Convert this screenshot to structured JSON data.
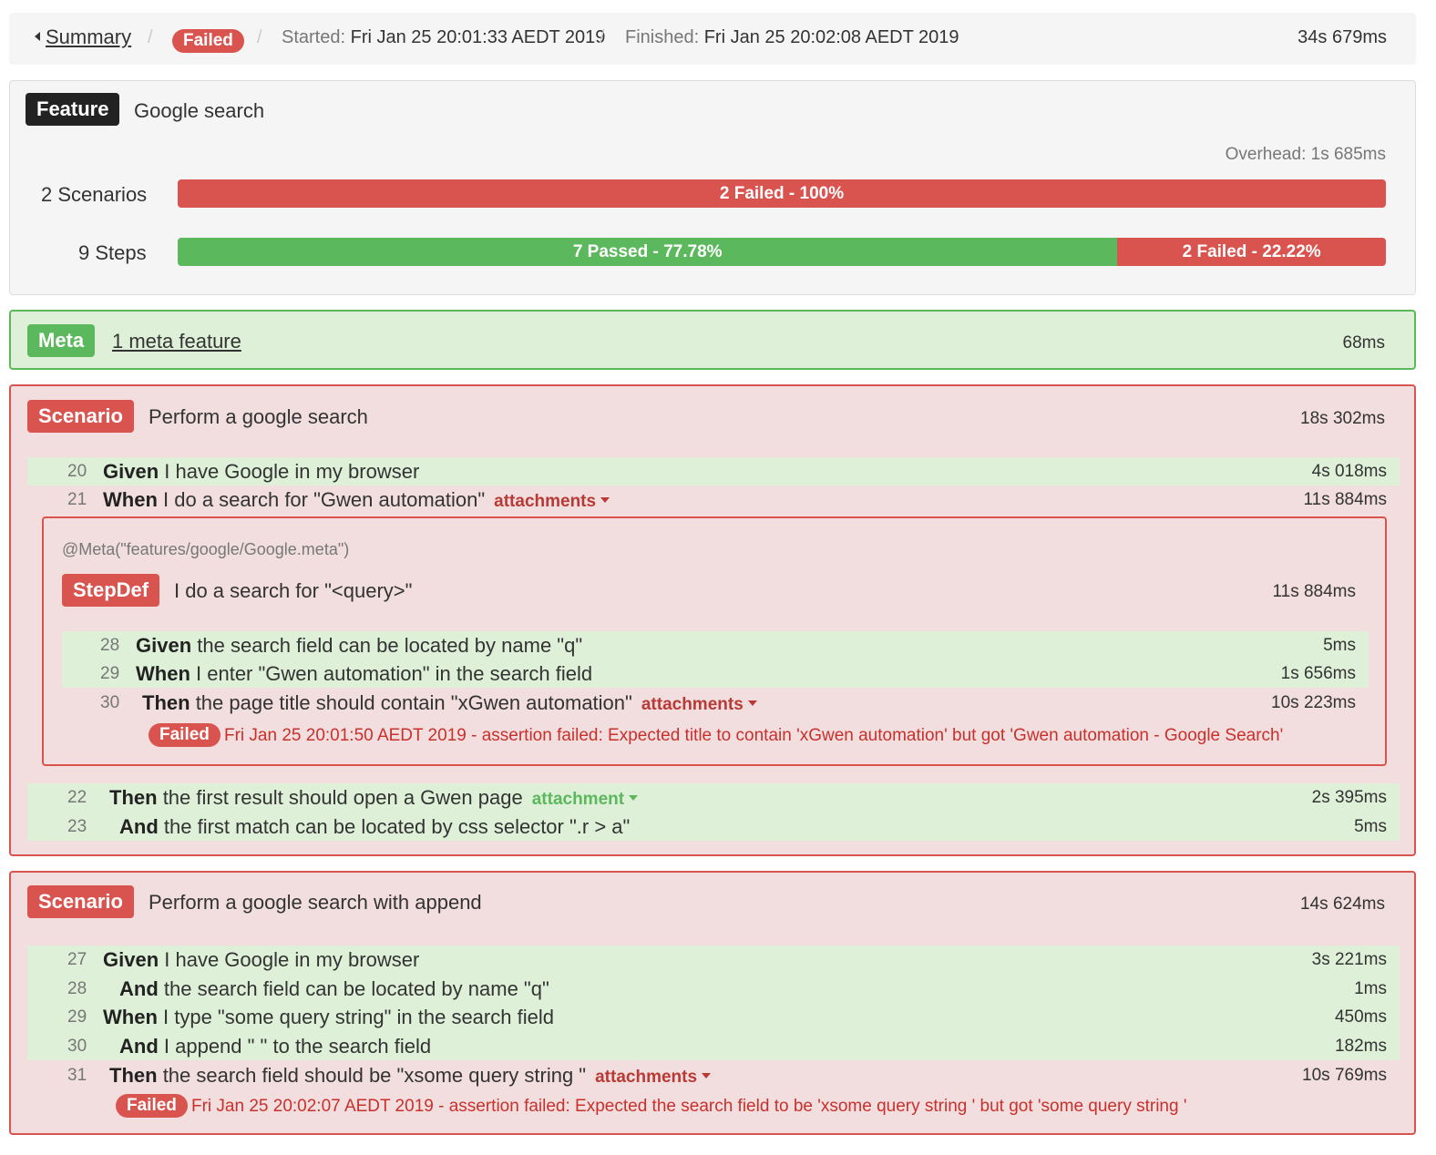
{
  "breadcrumb": {
    "summary": "Summary",
    "status": "Failed",
    "started_label": "Started:",
    "started": "Fri Jan 25 20:01:33 AEDT 2019",
    "finished_label": "Finished:",
    "finished": "Fri Jan 25 20:02:08 AEDT 2019",
    "duration": "34s 679ms"
  },
  "feature": {
    "label": "Feature",
    "name": "Google search",
    "overhead": "Overhead: 1s 685ms",
    "scenarios_label": "2 Scenarios",
    "scenarios_bar": [
      {
        "text": "2 Failed - 100%",
        "status": "failed",
        "percent": 100
      }
    ],
    "steps_label": "9 Steps",
    "steps_bar": [
      {
        "text": "7 Passed - 77.78%",
        "status": "passed",
        "percent": 77.78
      },
      {
        "text": "2 Failed - 22.22%",
        "status": "failed",
        "percent": 22.22
      }
    ]
  },
  "meta": {
    "label": "Meta",
    "link": "1 meta feature",
    "duration": "68ms"
  },
  "scenario1": {
    "label": "Scenario",
    "name": "Perform a google search",
    "duration": "18s 302ms",
    "steps": [
      {
        "line": "20",
        "keyword": "Given",
        "text": "I have Google in my browser",
        "duration": "4s 018ms"
      },
      {
        "line": "21",
        "keyword": "When",
        "text": "I do a search for \"Gwen automation\"",
        "duration": "11s 884ms",
        "attachment": "attachments"
      },
      {
        "line": "22",
        "keyword": "Then",
        "text": "the first result should open a Gwen page",
        "duration": "2s 395ms",
        "attachment": "attachment"
      },
      {
        "line": "23",
        "keyword": "And",
        "text": "the first match can be located by css selector \".r > a\"",
        "duration": "5ms"
      }
    ],
    "stepdef": {
      "annotation": "@Meta(\"features/google/Google.meta\")",
      "label": "StepDef",
      "name": "I do a search for \"<query>\"",
      "duration": "11s 884ms",
      "steps": [
        {
          "line": "28",
          "keyword": "Given",
          "text": "the search field can be located by name \"q\"",
          "duration": "5ms"
        },
        {
          "line": "29",
          "keyword": "When",
          "text": "I enter \"Gwen automation\" in the search field",
          "duration": "1s 656ms"
        },
        {
          "line": "30",
          "keyword": "Then",
          "text": "the page title should contain \"xGwen automation\"",
          "duration": "10s 223ms",
          "attachment": "attachments"
        }
      ],
      "error_badge": "Failed",
      "error": "Fri Jan 25 20:01:50 AEDT 2019 - assertion failed: Expected title to contain 'xGwen automation' but got 'Gwen automation - Google Search'"
    }
  },
  "scenario2": {
    "label": "Scenario",
    "name": "Perform a google search with append",
    "duration": "14s 624ms",
    "steps": [
      {
        "line": "27",
        "keyword": "Given",
        "text": "I have Google in my browser",
        "duration": "3s 221ms"
      },
      {
        "line": "28",
        "keyword": "And",
        "text": "the search field can be located by name \"q\"",
        "duration": "1ms"
      },
      {
        "line": "29",
        "keyword": "When",
        "text": "I type \"some query string\" in the search field",
        "duration": "450ms"
      },
      {
        "line": "30",
        "keyword": "And",
        "text": "I append \" \" to the search field",
        "duration": "182ms"
      },
      {
        "line": "31",
        "keyword": "Then",
        "text": "the search field should be \"xsome query string \"",
        "duration": "10s 769ms",
        "attachment": "attachments"
      }
    ],
    "error_badge": "Failed",
    "error": "Fri Jan 25 20:02:07 AEDT 2019 - assertion failed: Expected the search field to be 'xsome query string ' but got 'some query string '"
  },
  "colors": {
    "passed": "#5cb85c",
    "failed": "#d9534f",
    "passed_bg": "#dff0d8",
    "failed_bg": "#f2dede"
  }
}
